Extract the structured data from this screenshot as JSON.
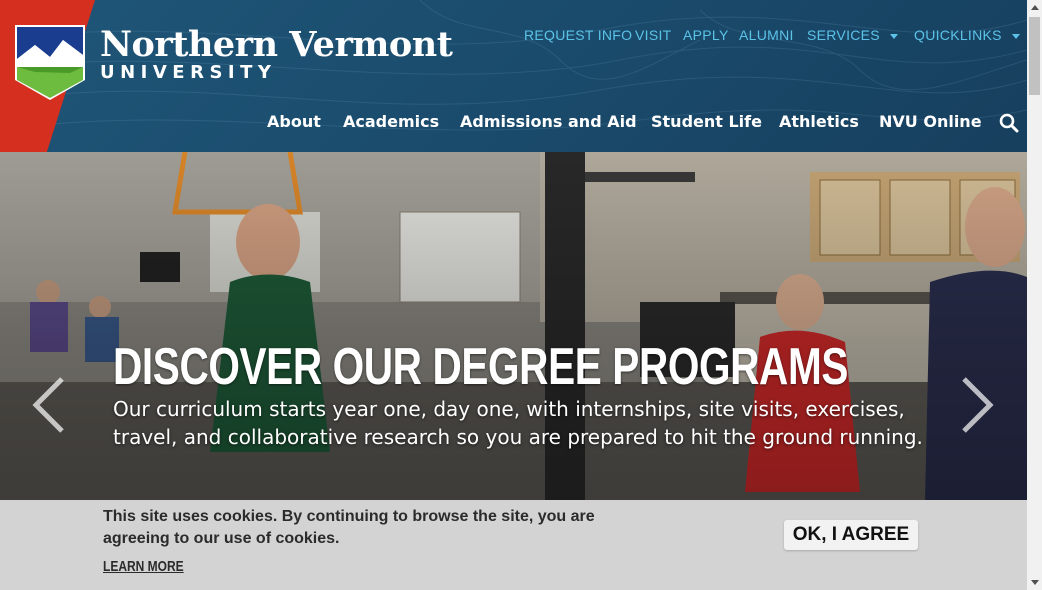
{
  "brand": {
    "name": "Northern Vermont",
    "subtitle": "UNIVERSITY"
  },
  "util_nav": [
    {
      "label": "REQUEST INFO"
    },
    {
      "label": "VISIT"
    },
    {
      "label": "APPLY"
    },
    {
      "label": "ALUMNI"
    },
    {
      "label": "SERVICES",
      "dropdown": true
    },
    {
      "label": "QUICKLINKS",
      "dropdown": true
    }
  ],
  "main_nav": [
    {
      "label": "About"
    },
    {
      "label": "Academics"
    },
    {
      "label": "Admissions and Aid"
    },
    {
      "label": "Student Life"
    },
    {
      "label": "Athletics"
    },
    {
      "label": "NVU Online"
    }
  ],
  "hero": {
    "title": "DISCOVER OUR DEGREE PROGRAMS",
    "description": "Our curriculum starts year one, day one, with internships, site visits, exercises, travel, and collaborative research so you are prepared to hit the ground running."
  },
  "cookie": {
    "message": "This site uses cookies. By continuing to browse the site, you are agreeing to our use of cookies.",
    "learn_more": "LEARN MORE",
    "agree": "OK, I AGREE"
  },
  "colors": {
    "header_bg": "#1a4a6b",
    "accent_red": "#d42f1f",
    "util_link": "#5bc3e8",
    "cookie_bg": "#d3d3d3"
  },
  "icons": {
    "search": "search-icon",
    "prev": "chevron-left-icon",
    "next": "chevron-right-icon"
  }
}
